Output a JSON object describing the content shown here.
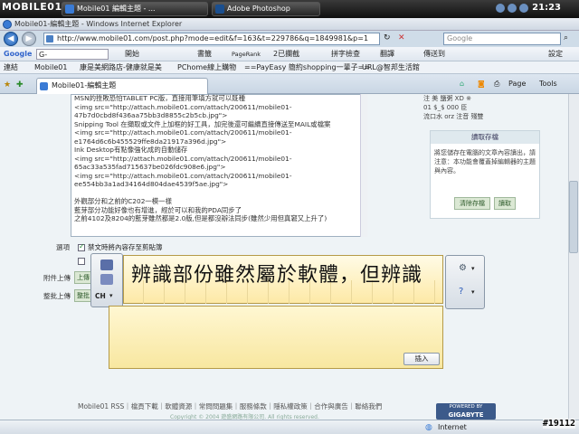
{
  "taskbar": {
    "logo": "MOBILE01",
    "buttons": [
      {
        "label": "Mobile01 編輯主題 - ..."
      },
      {
        "label": "Adobe Photoshop"
      }
    ],
    "clock": "21:23",
    "colors": {
      "ie": "#3a7bd5",
      "ps": "#1b4f8f"
    }
  },
  "browser": {
    "title": "Mobile01-編輯主題 - Windows Internet Explorer",
    "url": "http://www.mobile01.com/post.php?mode=edit&f=163&t=229786&q=1849981&p=1",
    "search_placeholder": "Google",
    "tab_label": "Mobile01-編輯主題"
  },
  "googlebar": {
    "brand": "Google",
    "items": [
      "G-",
      "開始",
      "書籤",
      "PageRank",
      "2已攔截",
      "拼字檢查",
      "翻譯",
      "傳送到",
      "設定"
    ]
  },
  "links": {
    "label": "連結",
    "items": [
      "Mobile01",
      "康是美網路店-健康就是美",
      "PChome線上購物",
      "==PayEasy 簡約shopping一輩子==",
      "URL@智邦生活館"
    ]
  },
  "command_bar": {
    "items": [
      "Page",
      "Tools"
    ]
  },
  "editor": {
    "lines": [
      "MSN的挫敗恐怕TABLET PC版，直接用筆填方就可以既種",
      "<img src=\"http://attach.mobile01.com/attach/200611/mobile01-",
      "47b7d0cbd8f436aa75bb3d8855c2b5cb.jpg\">",
      "Snipping Tool 在擷取或文件上加框的好工具，加完後還可繼續直接傳送至MAIL或檔案",
      "<img src=\"http://attach.mobile01.com/attach/200611/mobile01-",
      "e1764d6c6b455529ffe8da21917a396d.jpg\">",
      "Ink Desktop有點像強化成的自動儲存",
      "<img src=\"http://attach.mobile01.com/attach/200611/mobile01-",
      "65ac33a535fad715637be026fdc908e6.jpg\">",
      "<img src=\"http://attach.mobile01.com/attach/200611/mobile01-",
      "ee554bb3a1ad34164d804dae4539f5ae.jpg\">",
      "",
      "外觀部分和之前的C202一模一樣",
      "藍芽部分功能好像也有增進，經於可以和我的PDA同步了",
      "之前4102及8204的藍芽雖然都是2.0版,但是都沒辦法同步(雖然少用但真窘又上升了)"
    ]
  },
  "right_panel": {
    "lines": [
      "注 美 鹽粥 XD ※",
      "01 $_$ 000 臣",
      "流口水 orz 注音 殘雙"
    ]
  },
  "draft": {
    "title": "讀取存檔",
    "text": "將您儲存在電腦的文章內容讀出，請注意：本功能會覆蓋掉編輯器的主題與內容。",
    "btn_save": "清除存檔",
    "btn_load": "讀取"
  },
  "form_labels": {
    "options": "選項",
    "attach": "附件上傳",
    "attach_btn": "上傳",
    "organize": "整批上傳",
    "organize_btn": "整批",
    "check1": "禁文時將內容存至剪貼簿"
  },
  "ime": {
    "text": "辨識部份雖然屬於軟體，但辨識",
    "insert": "插入",
    "tool_label": "CH"
  },
  "footer": {
    "links": "Mobile01 RSS｜檔頁下載｜軟體資源｜常問問題集｜服務條款｜隱私權政策｜合作與廣告｜聯絡我們",
    "copyright": "Copyright © 2004 遊盛網路有限公司. All rights reserved.",
    "sponsor_top": "POWERED BY",
    "sponsor_name": "GIGABYTE"
  },
  "status": {
    "zone": "Internet"
  },
  "stamp": "#19112"
}
